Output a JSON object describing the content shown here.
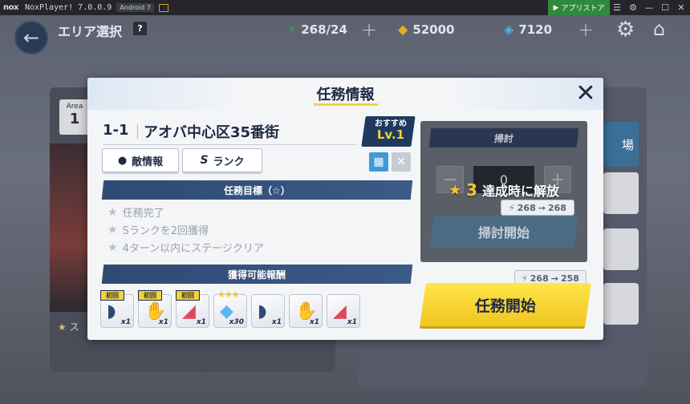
{
  "emulator": {
    "logo": "nox",
    "title": "NoxPlayer! 7.0.0.9",
    "android": "Android 7",
    "store_label": "アプリストア",
    "controls": [
      "menu-icon",
      "gear-icon",
      "minimize-icon",
      "maximize-icon",
      "close-icon"
    ]
  },
  "game": {
    "title": "エリア選択",
    "help": "?",
    "stamina": "268/24",
    "coins": "52000",
    "gems": "7120",
    "bg_area_label": "Area",
    "bg_area_num": "1",
    "bg_tab_label": "場",
    "bg_star_text": "ス"
  },
  "modal": {
    "title": "任務情報",
    "close": "✕",
    "stage_id": "1-1",
    "stage_name": "アオバ中心区35番街",
    "recommend_label": "おすすめ",
    "recommend_level": "Lv.1",
    "enemy_info_label": "敵情報",
    "rank_label": "ランク",
    "rank_letter": "S",
    "goals_header": "任務目標（☆）",
    "goals": [
      "任務完了",
      "Sランクを2回獲得",
      "4ターン以内にステージクリア"
    ],
    "rewards_header": "獲得可能報酬",
    "rewards": [
      {
        "tag": "初回",
        "qty": "x1",
        "icon": "cap-icon"
      },
      {
        "tag": "初回",
        "qty": "x1",
        "icon": "glove-icon"
      },
      {
        "tag": "初回",
        "qty": "x1",
        "icon": "shoe-icon"
      },
      {
        "tag": "",
        "qty": "x30",
        "icon": "crystal-icon",
        "stars": "★★★"
      },
      {
        "tag": "",
        "qty": "x1",
        "icon": "cap-icon"
      },
      {
        "tag": "",
        "qty": "x1",
        "icon": "glove-icon"
      },
      {
        "tag": "",
        "qty": "x1",
        "icon": "shoe-icon"
      }
    ],
    "sweep": {
      "title": "掃討",
      "count": "0",
      "minus": "−",
      "plus": "+",
      "lock_stars": "3",
      "lock_text": "達成時に解放",
      "stamina_from": "268",
      "stamina_to": "268",
      "button": "掃討開始"
    },
    "start": {
      "stamina_from": "268",
      "stamina_to": "258",
      "button": "任務開始"
    }
  },
  "colors": {
    "navy": "#1f2a44",
    "section": "#2f4a73",
    "yellow": "#f2d33a",
    "stamina_green": "#3aa14b"
  }
}
